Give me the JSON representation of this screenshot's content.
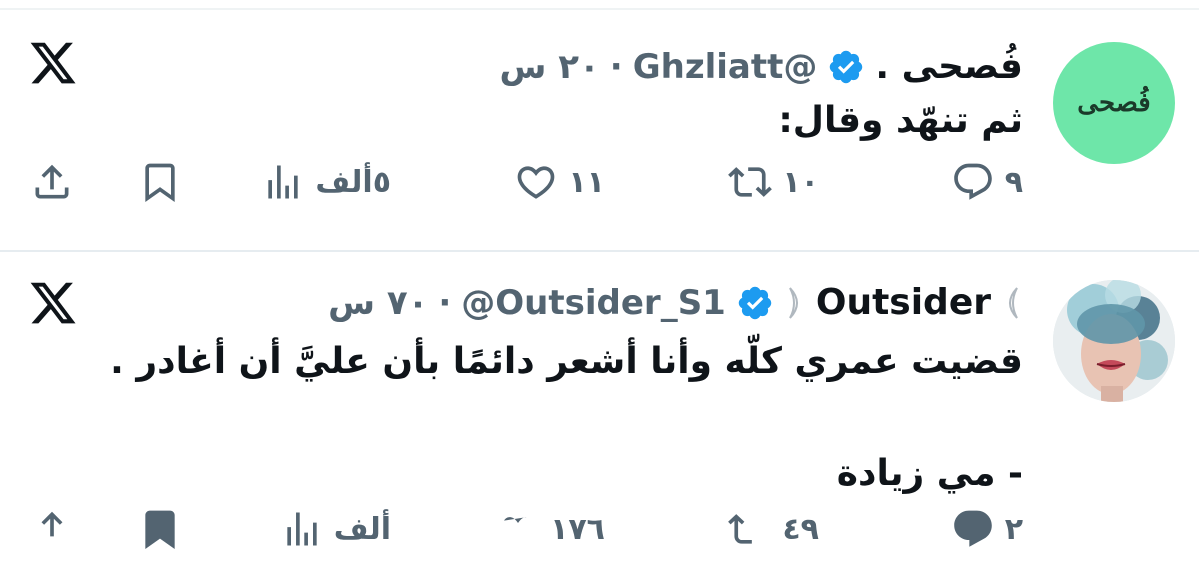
{
  "tweets": [
    {
      "avatar_text": "فُصحى",
      "avatar_bg": "#6ee6a9",
      "name": "فُصحى .",
      "handle": "@Ghzliatt",
      "time": "٢٠ س",
      "text": "ثم تنهّد وقال:",
      "stats": {
        "replies": "٩",
        "reposts": "١٠",
        "likes": "١١",
        "views": "٥ألف"
      },
      "icons": [
        "x-logo-icon",
        "verified-badge-icon",
        "reply-icon",
        "repost-icon",
        "like-icon",
        "views-icon",
        "bookmark-icon",
        "share-icon"
      ]
    },
    {
      "name_prefix": "🌙",
      "name": "Outsider",
      "name_suffix": "🌙",
      "handle": "@Outsider_S1",
      "time": "٧٠ س",
      "lines": [
        "قضيت عمري كلّه وأنا أشعر دائمًا بأن عليَّ أن أغادر .",
        "",
        "- مي زيادة"
      ],
      "stats": {
        "replies": "٢",
        "reposts": "٤٩",
        "likes": "١٧٦",
        "views": "ألف"
      }
    }
  ],
  "colors": {
    "text": "#0f1419",
    "muted": "#536471",
    "verified": "#1d9bf0",
    "divider": "#e6ecf0"
  }
}
